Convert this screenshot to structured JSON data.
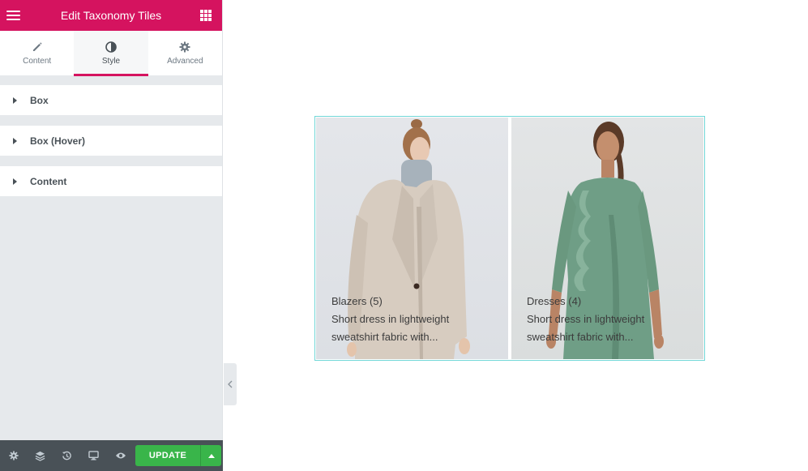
{
  "header": {
    "title": "Edit Taxonomy Tiles",
    "menu_icon": "hamburger-icon",
    "apps_icon": "grid-icon"
  },
  "tabs": [
    {
      "label": "Content",
      "icon": "pencil-icon",
      "active": false
    },
    {
      "label": "Style",
      "icon": "contrast-icon",
      "active": true
    },
    {
      "label": "Advanced",
      "icon": "gear-icon",
      "active": false
    }
  ],
  "sections": [
    {
      "label": "Box"
    },
    {
      "label": "Box (Hover)"
    },
    {
      "label": "Content"
    }
  ],
  "footer": {
    "update_label": "UPDATE",
    "icons": [
      "settings-icon",
      "layers-icon",
      "history-icon",
      "responsive-icon",
      "preview-eye-icon"
    ]
  },
  "tiles": [
    {
      "title": "Blazers (5)",
      "description": "Short dress in lightweight sweatshirt fabric with..."
    },
    {
      "title": "Dresses (4)",
      "description": "Short dress in lightweight sweatshirt fabric with..."
    }
  ],
  "colors": {
    "brand": "#d5135f",
    "update": "#39b54a",
    "footer": "#495157",
    "preview_border": "#71d7d7"
  }
}
